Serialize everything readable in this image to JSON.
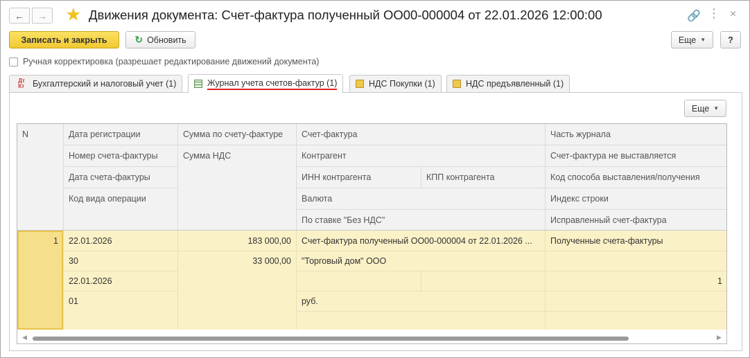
{
  "window": {
    "title": "Движения документа: Счет-фактура полученный ОО00-000004 от 22.01.2026 12:00:00",
    "back_glyph": "←",
    "forward_glyph": "→",
    "favorite_icon": "star-icon",
    "link_glyph": "🔗",
    "more_glyph": "⋮",
    "close_glyph": "×"
  },
  "toolbar": {
    "save_close_label": "Записать и закрыть",
    "refresh_label": "Обновить",
    "more_label": "Еще",
    "help_label": "?"
  },
  "manual_correction": {
    "label": "Ручная корректировка (разрешает редактирование движений документа)",
    "checked": false
  },
  "tabs": [
    {
      "label": "Бухгалтерский и налоговый учет (1)",
      "icon": "dt-kt-icon",
      "active": false
    },
    {
      "label": "Журнал учета счетов-фактур (1)",
      "icon": "register-grid-icon",
      "active": true
    },
    {
      "label": "НДС Покупки (1)",
      "icon": "document-icon",
      "active": false
    },
    {
      "label": "НДС предъявленный (1)",
      "icon": "document-icon",
      "active": false
    }
  ],
  "panel": {
    "more_label": "Еще"
  },
  "table": {
    "headers": {
      "n": "N",
      "reg_date": "Дата регистрации",
      "invoice_number": "Номер счета-фактуры",
      "invoice_date": "Дата счета-фактуры",
      "operation_code": "Код вида операции",
      "invoice_sum": "Сумма по счету-фактуре",
      "vat_sum": "Сумма НДС",
      "invoice": "Счет-фактура",
      "counterparty": "Контрагент",
      "inn": "ИНН контрагента",
      "kpp": "КПП контрагента",
      "currency": "Валюта",
      "no_vat_rate": "По ставке \"Без НДС\"",
      "journal_part": "Часть журнала",
      "not_issued": "Счет-фактура не выставляется",
      "issue_method": "Код способа выставления/получения",
      "line_index": "Индекс строки",
      "corrected_invoice": "Исправленный счет-фактура"
    },
    "rows": [
      {
        "n": "1",
        "reg_date": "22.01.2026",
        "invoice_number": "30",
        "invoice_date": "22.01.2026",
        "operation_code": "01",
        "invoice_sum": "183 000,00",
        "vat_sum": "33 000,00",
        "invoice": "Счет-фактура полученный ОО00-000004 от 22.01.2026 ...",
        "counterparty": "\"Торговый дом\" ООО",
        "inn": "",
        "kpp": "",
        "currency": "руб.",
        "no_vat_rate": "",
        "journal_part": "Полученные счета-фактуры",
        "not_issued": "",
        "issue_method": "1",
        "line_index": "",
        "corrected_invoice": ""
      }
    ]
  },
  "colors": {
    "primary_button": "#f1c932",
    "selected_row": "#fbf1c7",
    "selected_cell": "#f6df8a",
    "active_tab_underline": "#e02020"
  }
}
